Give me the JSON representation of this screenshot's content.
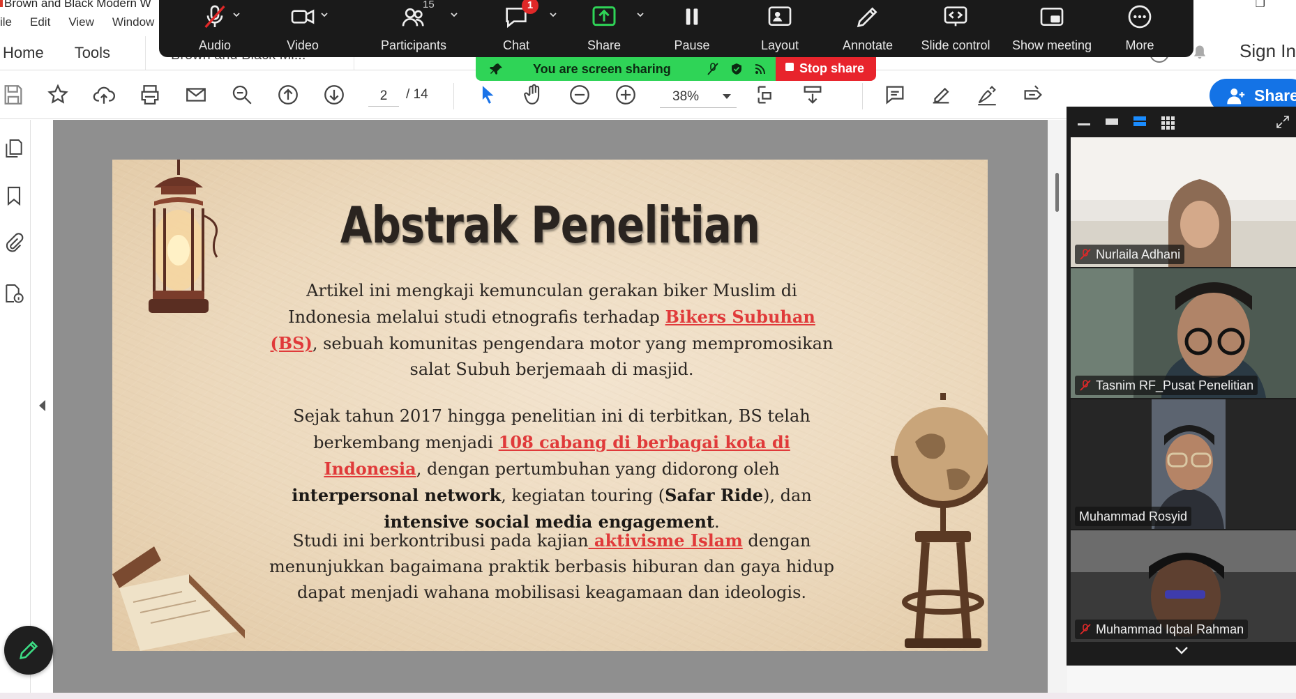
{
  "titlebar": {
    "doc_title": "Brown and Black Modern W"
  },
  "menubar": {
    "items": [
      "ile",
      "Edit",
      "View",
      "Window"
    ]
  },
  "appnav": {
    "home": "Home",
    "tools": "Tools",
    "doc_tab": "Brown and Black Mi...",
    "sign_in": "Sign In"
  },
  "toolbar": {
    "page_current": "2",
    "page_total": "/  14",
    "zoom": "38%",
    "share_label": "Share"
  },
  "zoom": {
    "controls": [
      {
        "label": "Audio",
        "icon": "mic-muted-icon"
      },
      {
        "label": "Video",
        "icon": "video-camera-icon"
      },
      {
        "label": "Participants",
        "icon": "participants-icon",
        "count": "15"
      },
      {
        "label": "Chat",
        "icon": "chat-icon",
        "badge": "1"
      },
      {
        "label": "Share",
        "icon": "share-screen-icon"
      },
      {
        "label": "Pause",
        "icon": "pause-icon"
      },
      {
        "label": "Layout",
        "icon": "layout-icon"
      },
      {
        "label": "Annotate",
        "icon": "pencil-icon"
      },
      {
        "label": "Slide control",
        "icon": "slide-control-icon"
      },
      {
        "label": "Show meeting",
        "icon": "show-meeting-icon"
      },
      {
        "label": "More",
        "icon": "more-icon"
      }
    ],
    "sharing_status": "You are screen sharing",
    "stop_share": "Stop share",
    "accent_green": "#2fd457",
    "accent_red": "#e8242c"
  },
  "participants": [
    {
      "name": "Nurlaila Adhani",
      "muted": true
    },
    {
      "name": "Tasnim RF_Pusat Penelitian",
      "muted": true
    },
    {
      "name": "Muhammad Rosyid",
      "muted": false,
      "active_speaker": true
    },
    {
      "name": "Muhammad Iqbal Rahman",
      "muted": true
    }
  ],
  "slide": {
    "title": "Abstrak Penelitian",
    "p1": {
      "a": "Artikel ini mengkaji kemunculan gerakan biker Muslim di Indonesia melalui studi etnografis terhadap ",
      "link": "Bikers Subuhan (BS)",
      "b": ", sebuah komunitas pengendara motor yang mempromosikan salat Subuh berjemaah di masjid."
    },
    "p2": {
      "a": "Sejak tahun 2017 hingga penelitian ini di terbitkan, BS telah berkembang menjadi ",
      "link": "108 cabang di berbagai kota di Indonesia",
      "b": ", dengan pertumbuhan yang didorong oleh ",
      "bold1": "interpersonal network",
      "c": ", kegiatan touring (",
      "bold2": "Safar Ride",
      "d": "), dan ",
      "bold3": "intensive social media engagement",
      "e": "."
    },
    "p3": {
      "a": "Studi ini berkontribusi pada kajian",
      "link": " aktivisme Islam",
      "b": " dengan menunjukkan bagaimana praktik berbasis hiburan dan gaya hidup dapat menjadi wahana mobilisasi keagamaan dan ideologis."
    }
  }
}
